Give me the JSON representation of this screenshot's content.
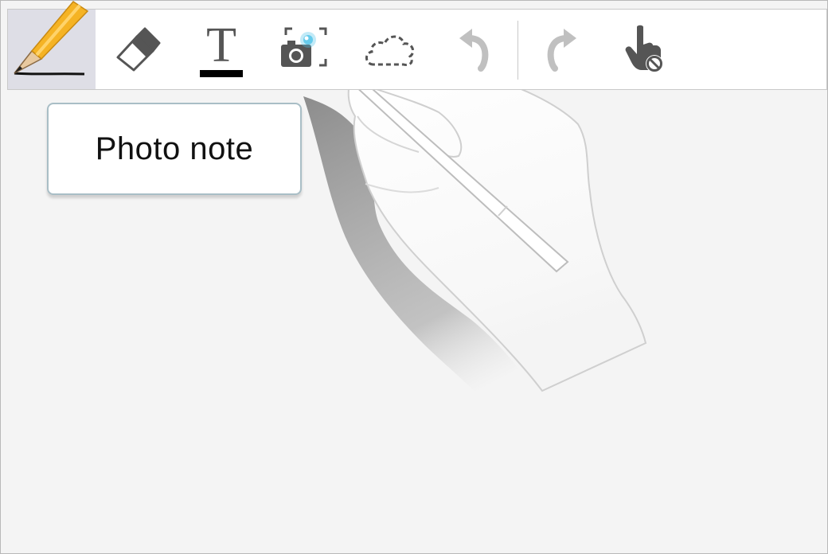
{
  "toolbar": {
    "tools": [
      {
        "id": "pen",
        "icon": "pencil-icon",
        "active": true
      },
      {
        "id": "eraser",
        "icon": "eraser-icon"
      },
      {
        "id": "text",
        "icon": "text-icon"
      },
      {
        "id": "photo",
        "icon": "camera-icon"
      },
      {
        "id": "lasso",
        "icon": "lasso-cloud-icon"
      },
      {
        "id": "undo",
        "icon": "undo-icon",
        "enabled": false
      },
      {
        "id": "redo",
        "icon": "redo-icon",
        "enabled": false
      },
      {
        "id": "hand",
        "icon": "hand-block-icon"
      }
    ],
    "text_tool_glyph": "T"
  },
  "tooltip": {
    "label": "Photo note"
  },
  "colors": {
    "active_tool_bg": "#dedee6",
    "pencil_body": "#f5b324",
    "icon_dark": "#555555",
    "icon_disabled": "#c0c0c0",
    "photo_highlight": "#4fc3e8",
    "tooltip_border": "#a9bec6"
  }
}
